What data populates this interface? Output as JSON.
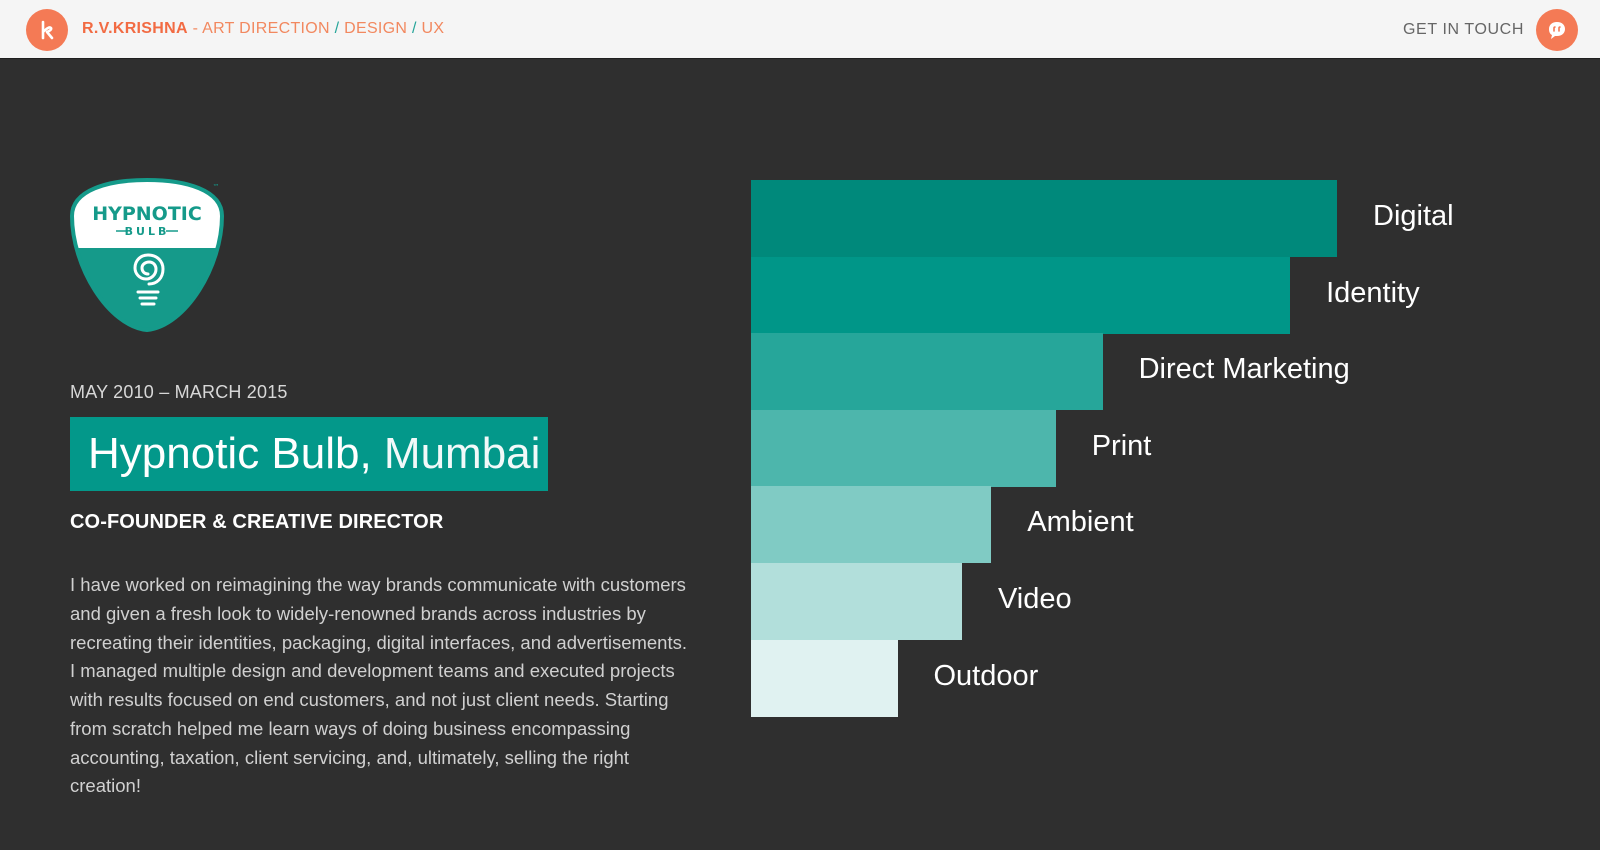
{
  "header": {
    "brand_name": "R.V.KRISHNA",
    "brand_dash": " - ",
    "nav": [
      "ART DIRECTION",
      "DESIGN",
      "UX"
    ],
    "separator": " / ",
    "contact_label": "GET IN TOUCH",
    "logo_icon": "k-letter-icon",
    "contact_icon": "chat-bubble-icon",
    "accent": "#f47a55"
  },
  "company": {
    "logo_word_1": "HYPNOTIC",
    "logo_word_2": "BULB",
    "logo_tm": "™",
    "period": "MAY 2010 – MARCH 2015",
    "name": "Hypnotic Bulb,",
    "city": " Mumbai",
    "role": "CO-FOUNDER & CREATIVE DIRECTOR",
    "bio": "I have worked on reimagining the way brands communicate with customers and given a fresh look to widely-renowned brands across industries by recreating their identities, packaging, digital interfaces, and advertisements.  I managed multiple design and development teams and executed projects with results focused on end customers, and not just client needs. Starting from scratch helped me learn ways of doing business encompassing accounting, taxation, client servicing, and, ultimately, selling the right creation!",
    "accent": "#03988a"
  },
  "chart_data": {
    "type": "bar",
    "orientation": "horizontal",
    "categories": [
      "Digital",
      "Identity",
      "Direct Marketing",
      "Print",
      "Ambient",
      "Video",
      "Outdoor"
    ],
    "values": [
      100,
      92,
      60,
      52,
      41,
      36,
      25
    ],
    "colors": [
      "#00897b",
      "#009688",
      "#26a69a",
      "#4db6ac",
      "#80cbc4",
      "#b2dfdb",
      "#e0f2f1"
    ],
    "title": "",
    "xlabel": "",
    "ylabel": "",
    "grid": false,
    "legend": "none"
  }
}
